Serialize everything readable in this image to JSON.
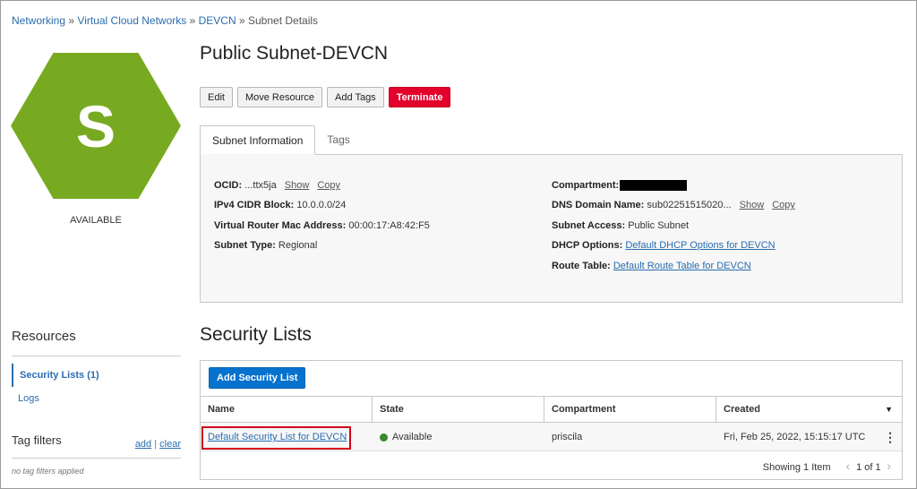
{
  "breadcrumb": {
    "items": [
      "Networking",
      "Virtual Cloud Networks",
      "DEVCN"
    ],
    "separator": "»",
    "current": "Subnet Details"
  },
  "subnet": {
    "initial": "S",
    "status": "AVAILABLE",
    "title": "Public Subnet-DEVCN",
    "hex_color": "#78aa21"
  },
  "actions": {
    "edit": "Edit",
    "move": "Move Resource",
    "add_tags": "Add Tags",
    "terminate": "Terminate"
  },
  "tabs": {
    "info": "Subnet Information",
    "tags": "Tags"
  },
  "info": {
    "ocid_label": "OCID:",
    "ocid_value": "...ttx5ja",
    "show": "Show",
    "copy": "Copy",
    "cidr_label": "IPv4 CIDR Block:",
    "cidr_value": "10.0.0.0/24",
    "mac_label": "Virtual Router Mac Address:",
    "mac_value": "00:00:17:A8:42:F5",
    "type_label": "Subnet Type:",
    "type_value": "Regional",
    "compartment_label": "Compartment:",
    "dns_label": "DNS Domain Name:",
    "dns_value": "sub02251515020...",
    "access_label": "Subnet Access:",
    "access_value": "Public Subnet",
    "dhcp_label": "DHCP Options:",
    "dhcp_value": "Default DHCP Options for DEVCN",
    "route_label": "Route Table:",
    "route_value": "Default Route Table for DEVCN"
  },
  "resources": {
    "title": "Resources",
    "items": [
      "Security Lists (1)",
      "Logs"
    ]
  },
  "tag_filters": {
    "title": "Tag filters",
    "add": "add",
    "divider": "|",
    "clear": "clear",
    "empty": "no tag filters applied"
  },
  "security_lists": {
    "title": "Security Lists",
    "add_button": "Add Security List",
    "columns": [
      "Name",
      "State",
      "Compartment",
      "Created"
    ],
    "rows": [
      {
        "name": "Default Security List for DEVCN",
        "state": "Available",
        "compartment": "priscila",
        "created": "Fri, Feb 25, 2022, 15:15:17 UTC"
      }
    ],
    "state_color": "#3a8a2e",
    "pager": {
      "showing": "Showing 1 Item",
      "page": "1 of 1"
    }
  }
}
